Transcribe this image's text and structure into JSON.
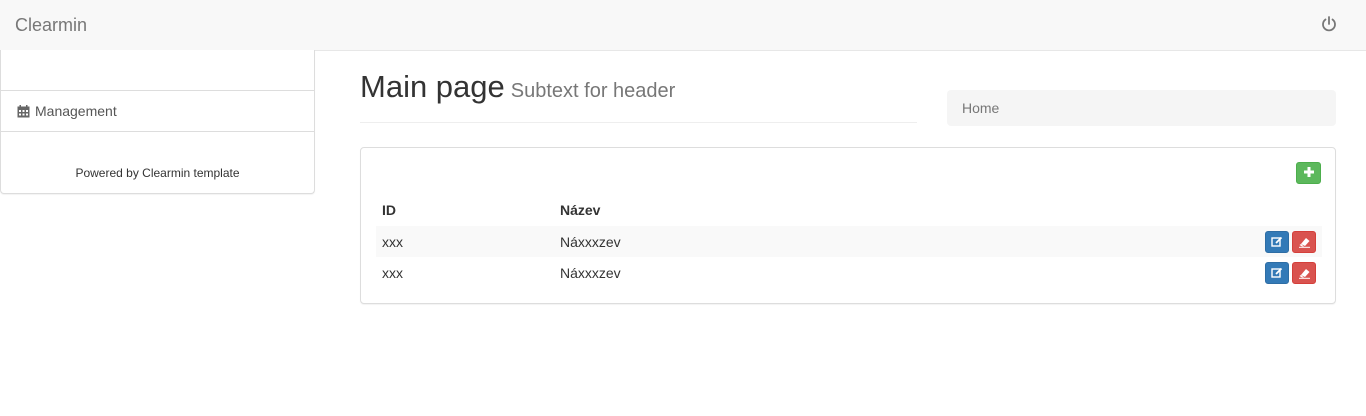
{
  "navbar": {
    "brand": "Clearmin",
    "power_icon": "power-icon"
  },
  "sidebar": {
    "items": [
      {
        "label": "Management",
        "icon": "calendar-icon"
      }
    ],
    "footer": "Powered by Clearmin template"
  },
  "header": {
    "title": "Main page",
    "subtitle": "Subtext for header"
  },
  "breadcrumb": {
    "items": [
      "Home"
    ]
  },
  "table": {
    "columns": [
      "ID",
      "Název"
    ],
    "rows": [
      {
        "id": "xxx",
        "name": "Náxxxzev"
      },
      {
        "id": "xxx",
        "name": "Náxxxzev"
      }
    ]
  },
  "colors": {
    "add": "#5cb85c",
    "edit": "#337ab7",
    "delete": "#d9534f"
  }
}
